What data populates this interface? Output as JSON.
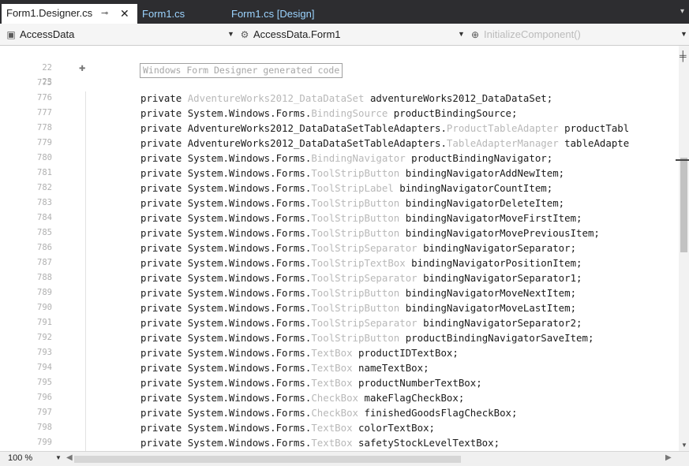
{
  "tabs": [
    {
      "label": "Form1.Designer.cs",
      "active": true
    },
    {
      "label": "Form1.cs",
      "active": false
    },
    {
      "label": "Form1.cs [Design]",
      "active": false
    }
  ],
  "tab_icons": {
    "pin": "⊸",
    "close": "✕"
  },
  "navbar": {
    "project": "AccessData",
    "class": "AccessData.Form1",
    "member": "InitializeComponent()"
  },
  "editor": {
    "region_label": "Windows Form Designer generated code",
    "region_line_numbers": [
      "22",
      "23"
    ],
    "lines": [
      {
        "num": "775",
        "kw": "",
        "type_ns": "",
        "type_cls": "",
        "name": ""
      },
      {
        "num": "776",
        "kw": "private",
        "type_ns": "",
        "type_cls": "AdventureWorks2012_DataDataSet",
        "name": "adventureWorks2012_DataDataSet;"
      },
      {
        "num": "777",
        "kw": "private",
        "type_ns": "System.Windows.Forms.",
        "type_cls": "BindingSource",
        "name": "productBindingSource;"
      },
      {
        "num": "778",
        "kw": "private",
        "type_ns": "AdventureWorks2012_DataDataSetTableAdapters.",
        "type_cls": "ProductTableAdapter",
        "name": "productTabl"
      },
      {
        "num": "779",
        "kw": "private",
        "type_ns": "AdventureWorks2012_DataDataSetTableAdapters.",
        "type_cls": "TableAdapterManager",
        "name": "tableAdapte"
      },
      {
        "num": "780",
        "kw": "private",
        "type_ns": "System.Windows.Forms.",
        "type_cls": "BindingNavigator",
        "name": "productBindingNavigator;"
      },
      {
        "num": "781",
        "kw": "private",
        "type_ns": "System.Windows.Forms.",
        "type_cls": "ToolStripButton",
        "name": "bindingNavigatorAddNewItem;"
      },
      {
        "num": "782",
        "kw": "private",
        "type_ns": "System.Windows.Forms.",
        "type_cls": "ToolStripLabel",
        "name": "bindingNavigatorCountItem;"
      },
      {
        "num": "783",
        "kw": "private",
        "type_ns": "System.Windows.Forms.",
        "type_cls": "ToolStripButton",
        "name": "bindingNavigatorDeleteItem;"
      },
      {
        "num": "784",
        "kw": "private",
        "type_ns": "System.Windows.Forms.",
        "type_cls": "ToolStripButton",
        "name": "bindingNavigatorMoveFirstItem;"
      },
      {
        "num": "785",
        "kw": "private",
        "type_ns": "System.Windows.Forms.",
        "type_cls": "ToolStripButton",
        "name": "bindingNavigatorMovePreviousItem;"
      },
      {
        "num": "786",
        "kw": "private",
        "type_ns": "System.Windows.Forms.",
        "type_cls": "ToolStripSeparator",
        "name": "bindingNavigatorSeparator;"
      },
      {
        "num": "787",
        "kw": "private",
        "type_ns": "System.Windows.Forms.",
        "type_cls": "ToolStripTextBox",
        "name": "bindingNavigatorPositionItem;"
      },
      {
        "num": "788",
        "kw": "private",
        "type_ns": "System.Windows.Forms.",
        "type_cls": "ToolStripSeparator",
        "name": "bindingNavigatorSeparator1;"
      },
      {
        "num": "789",
        "kw": "private",
        "type_ns": "System.Windows.Forms.",
        "type_cls": "ToolStripButton",
        "name": "bindingNavigatorMoveNextItem;"
      },
      {
        "num": "790",
        "kw": "private",
        "type_ns": "System.Windows.Forms.",
        "type_cls": "ToolStripButton",
        "name": "bindingNavigatorMoveLastItem;"
      },
      {
        "num": "791",
        "kw": "private",
        "type_ns": "System.Windows.Forms.",
        "type_cls": "ToolStripSeparator",
        "name": "bindingNavigatorSeparator2;"
      },
      {
        "num": "792",
        "kw": "private",
        "type_ns": "System.Windows.Forms.",
        "type_cls": "ToolStripButton",
        "name": "productBindingNavigatorSaveItem;"
      },
      {
        "num": "793",
        "kw": "private",
        "type_ns": "System.Windows.Forms.",
        "type_cls": "TextBox",
        "name": "productIDTextBox;"
      },
      {
        "num": "794",
        "kw": "private",
        "type_ns": "System.Windows.Forms.",
        "type_cls": "TextBox",
        "name": "nameTextBox;"
      },
      {
        "num": "795",
        "kw": "private",
        "type_ns": "System.Windows.Forms.",
        "type_cls": "TextBox",
        "name": "productNumberTextBox;"
      },
      {
        "num": "796",
        "kw": "private",
        "type_ns": "System.Windows.Forms.",
        "type_cls": "CheckBox",
        "name": "makeFlagCheckBox;"
      },
      {
        "num": "797",
        "kw": "private",
        "type_ns": "System.Windows.Forms.",
        "type_cls": "CheckBox",
        "name": "finishedGoodsFlagCheckBox;"
      },
      {
        "num": "798",
        "kw": "private",
        "type_ns": "System.Windows.Forms.",
        "type_cls": "TextBox",
        "name": "colorTextBox;"
      },
      {
        "num": "799",
        "kw": "private",
        "type_ns": "System.Windows.Forms.",
        "type_cls": "TextBox",
        "name": "safetyStockLevelTextBox;"
      }
    ]
  },
  "status": {
    "zoom": "100 %"
  },
  "colors": {
    "tab_bar": "#2d2d30",
    "inactive_tab_text": "#9cd4ff",
    "type_gray": "#b8b8b8"
  }
}
